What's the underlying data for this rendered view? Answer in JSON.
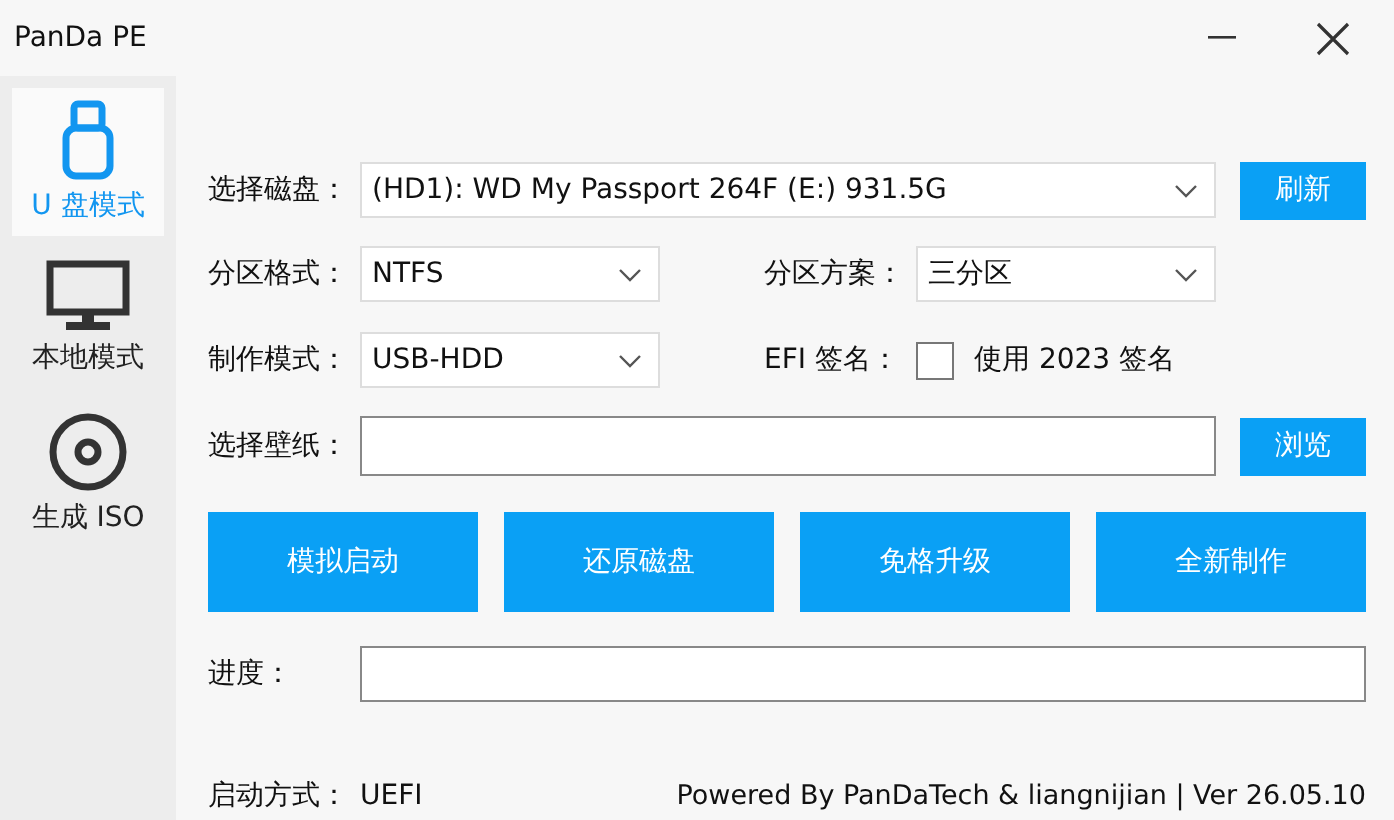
{
  "window": {
    "title": "PanDa PE"
  },
  "sidebar": {
    "items": [
      {
        "kind": "usb",
        "label": "U 盘模式",
        "selected": true
      },
      {
        "kind": "monitor",
        "label": "本地模式",
        "selected": false
      },
      {
        "kind": "disc",
        "label": "生成 ISO",
        "selected": false
      }
    ]
  },
  "disk": {
    "label": "选择磁盘：",
    "value": "(HD1): WD My Passport 264F (E:) 931.5G",
    "button": "刷新"
  },
  "partition_format": {
    "label": "分区格式：",
    "value": "NTFS"
  },
  "partition_scheme": {
    "label": "分区方案：",
    "value": "三分区"
  },
  "make_mode": {
    "label": "制作模式：",
    "value": "USB-HDD"
  },
  "efi": {
    "label": "EFI 签名：",
    "option": "使用 2023 签名",
    "checked": false
  },
  "wallpaper": {
    "label": "选择壁纸：",
    "button": "浏览"
  },
  "actions": [
    "模拟启动",
    "还原磁盘",
    "免格升级",
    "全新制作"
  ],
  "progress": {
    "label": "进度："
  },
  "footer": {
    "boot_label": "启动方式：",
    "boot_value": "UEFI",
    "credits": "Powered By PanDaTech & liangnijian | Ver 26.05.10"
  }
}
